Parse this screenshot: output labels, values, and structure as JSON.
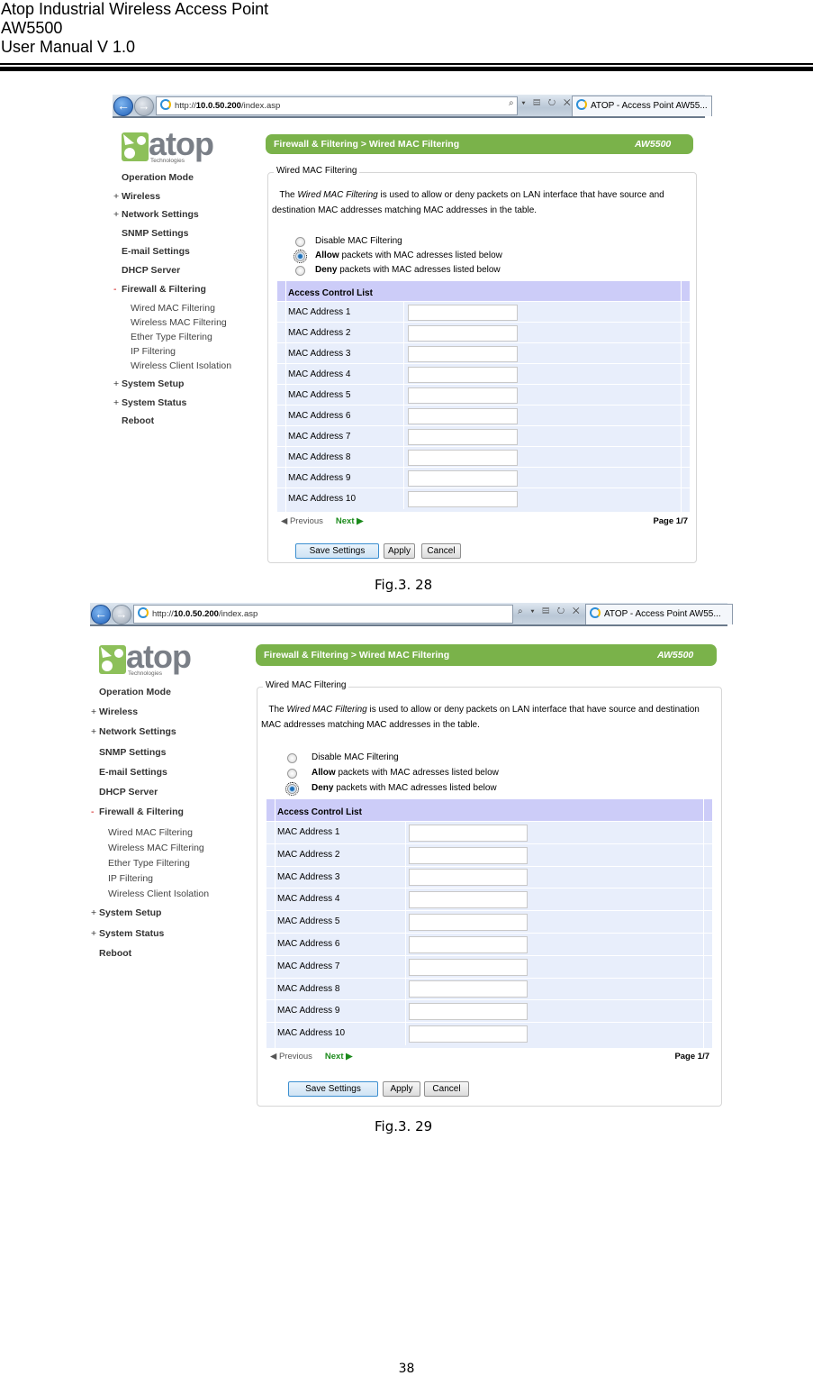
{
  "header": {
    "line1": "Atop Industrial Wireless Access Point",
    "line2": "AW5500",
    "line3": "User Manual V 1.0"
  },
  "browser": {
    "url_prefix": "http://",
    "url_host": "10.0.50.200",
    "url_path": "/index.asp",
    "tools": "⌕ ▾ ▤ ↻ ✕",
    "tab_title": "ATOP - Access Point AW55..."
  },
  "logo": {
    "word": "atop",
    "sub": "Technologies"
  },
  "sidebar": {
    "items": [
      {
        "prefix": "",
        "label": "Operation Mode"
      },
      {
        "prefix": "+",
        "label": "Wireless"
      },
      {
        "prefix": "+",
        "label": "Network Settings"
      },
      {
        "prefix": "",
        "label": "SNMP Settings"
      },
      {
        "prefix": "",
        "label": "E-mail Settings"
      },
      {
        "prefix": "",
        "label": "DHCP Server"
      },
      {
        "prefix": "-",
        "label": "Firewall & Filtering"
      },
      {
        "prefix": "+",
        "label": "System Setup"
      },
      {
        "prefix": "+",
        "label": "System Status"
      },
      {
        "prefix": "",
        "label": "Reboot"
      }
    ],
    "subitems": [
      "Wired MAC Filtering",
      "Wireless MAC Filtering",
      "Ether Type Filtering",
      "IP Filtering",
      "Wireless Client Isolation"
    ]
  },
  "titlebar": {
    "breadcrumb": "Firewall & Filtering > Wired MAC Filtering",
    "model": "AW5500"
  },
  "panel": {
    "legend": "Wired MAC Filtering",
    "desc_pre": "The ",
    "desc_em": "Wired MAC Filtering",
    "desc_post": " is used to allow or deny packets on LAN interface that have source and destination MAC addresses matching MAC addresses in the table.",
    "radios": [
      {
        "bold": "",
        "text": "Disable MAC Filtering"
      },
      {
        "bold": "Allow",
        "text": " packets with MAC adresses listed below"
      },
      {
        "bold": "Deny",
        "text": " packets with MAC adresses listed below"
      }
    ],
    "acl_title": "Access Control List",
    "mac_labels": [
      "MAC Address 1",
      "MAC Address 2",
      "MAC Address 3",
      "MAC Address 4",
      "MAC Address 5",
      "MAC Address 6",
      "MAC Address 7",
      "MAC Address 8",
      "MAC Address 9",
      "MAC Address 10"
    ],
    "mac_values": [
      "",
      "",
      "",
      "",
      "",
      "",
      "",
      "",
      "",
      ""
    ],
    "prev": "◀ Previous",
    "next": "Next ▶",
    "page": "Page 1/7",
    "save": "Save Settings",
    "apply": "Apply",
    "cancel": "Cancel"
  },
  "figures": [
    {
      "caption": "Fig.3. 28",
      "selected_radio": "Allow"
    },
    {
      "caption": "Fig.3. 29",
      "selected_radio": "Deny"
    }
  ],
  "page_number": "38"
}
